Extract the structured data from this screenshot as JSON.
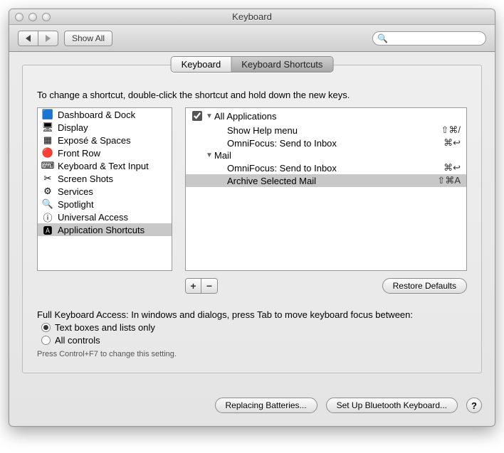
{
  "window": {
    "title": "Keyboard"
  },
  "toolbar": {
    "show_all": "Show All",
    "search_placeholder": ""
  },
  "tabs": {
    "keyboard": "Keyboard",
    "shortcuts": "Keyboard Shortcuts",
    "active": "shortcuts"
  },
  "instruction": "To change a shortcut, double-click the shortcut and hold down the new keys.",
  "categories": [
    {
      "id": "dashboard",
      "label": "Dashboard & Dock",
      "icon": "🟦",
      "selected": false
    },
    {
      "id": "display",
      "label": "Display",
      "icon": "🖥",
      "selected": false
    },
    {
      "id": "expose",
      "label": "Exposé & Spaces",
      "icon": "▦",
      "selected": false
    },
    {
      "id": "frontrow",
      "label": "Front Row",
      "icon": "🔴",
      "selected": false
    },
    {
      "id": "kbtext",
      "label": "Keyboard & Text Input",
      "icon": "⌨",
      "selected": false
    },
    {
      "id": "screenshots",
      "label": "Screen Shots",
      "icon": "✂",
      "selected": false
    },
    {
      "id": "services",
      "label": "Services",
      "icon": "⚙",
      "selected": false
    },
    {
      "id": "spotlight",
      "label": "Spotlight",
      "icon": "🔍",
      "selected": false
    },
    {
      "id": "universal",
      "label": "Universal Access",
      "icon": "ⓘ",
      "selected": false
    },
    {
      "id": "appshortcuts",
      "label": "Application Shortcuts",
      "icon": "🅰",
      "selected": true
    }
  ],
  "shortcuts": [
    {
      "type": "group",
      "label": "All Applications",
      "checked": true
    },
    {
      "type": "item",
      "label": "Show Help menu",
      "shortcut": "⇧⌘/"
    },
    {
      "type": "item",
      "label": "OmniFocus: Send to Inbox",
      "shortcut": "⌘↩"
    },
    {
      "type": "group",
      "label": "Mail",
      "checked": null
    },
    {
      "type": "item",
      "label": "OmniFocus: Send to Inbox",
      "shortcut": "⌘↩"
    },
    {
      "type": "item",
      "label": "Archive Selected Mail",
      "shortcut": "⇧⌘A",
      "selected": true
    }
  ],
  "buttons": {
    "add": "+",
    "remove": "−",
    "restore": "Restore Defaults",
    "replacing": "Replacing Batteries...",
    "bluetooth": "Set Up Bluetooth Keyboard...",
    "help": "?"
  },
  "fka": {
    "label": "Full Keyboard Access: In windows and dialogs, press Tab to move keyboard focus between:",
    "opt1": "Text boxes and lists only",
    "opt2": "All controls",
    "selected": "opt1",
    "hint": "Press Control+F7 to change this setting."
  },
  "search": {
    "icon": "🔍"
  }
}
